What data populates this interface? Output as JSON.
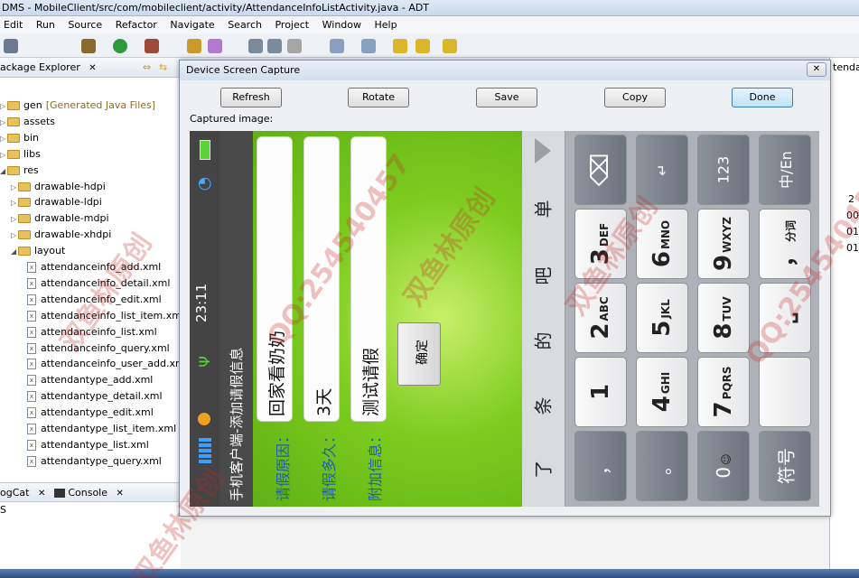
{
  "window": {
    "title": "DMS - MobileClient/src/com/mobileclient/activity/AttendanceInfoListActivity.java - ADT"
  },
  "menu": [
    "Edit",
    "Run",
    "Source",
    "Refactor",
    "Navigate",
    "Search",
    "Project",
    "Window",
    "Help"
  ],
  "package_explorer": {
    "title": "ackage Explorer",
    "items": [
      {
        "label": "gen",
        "suffix": "[Generated Java Files]",
        "kind": "folder",
        "depth": 0,
        "open": false
      },
      {
        "label": "assets",
        "kind": "folder",
        "depth": 0,
        "open": false
      },
      {
        "label": "bin",
        "kind": "folder",
        "depth": 0,
        "open": false
      },
      {
        "label": "libs",
        "kind": "folder",
        "depth": 0,
        "open": false
      },
      {
        "label": "res",
        "kind": "folder",
        "depth": 0,
        "open": true
      },
      {
        "label": "drawable-hdpi",
        "kind": "folder",
        "depth": 1,
        "open": false
      },
      {
        "label": "drawable-ldpi",
        "kind": "folder",
        "depth": 1,
        "open": false
      },
      {
        "label": "drawable-mdpi",
        "kind": "folder",
        "depth": 1,
        "open": false
      },
      {
        "label": "drawable-xhdpi",
        "kind": "folder",
        "depth": 1,
        "open": false
      },
      {
        "label": "layout",
        "kind": "folder",
        "depth": 1,
        "open": true
      },
      {
        "label": "attendanceinfo_add.xml",
        "kind": "file",
        "depth": 2
      },
      {
        "label": "attendanceinfo_detail.xml",
        "kind": "file",
        "depth": 2
      },
      {
        "label": "attendanceinfo_edit.xml",
        "kind": "file",
        "depth": 2
      },
      {
        "label": "attendanceinfo_list_item.xml",
        "kind": "file",
        "depth": 2
      },
      {
        "label": "attendanceinfo_list.xml",
        "kind": "file",
        "depth": 2
      },
      {
        "label": "attendanceinfo_query.xml",
        "kind": "file",
        "depth": 2
      },
      {
        "label": "attendanceinfo_user_add.xml",
        "kind": "file",
        "depth": 2
      },
      {
        "label": "attendantype_add.xml",
        "kind": "file",
        "depth": 2
      },
      {
        "label": "attendantype_detail.xml",
        "kind": "file",
        "depth": 2
      },
      {
        "label": "attendantype_edit.xml",
        "kind": "file",
        "depth": 2
      },
      {
        "label": "attendantype_list_item.xml",
        "kind": "file",
        "depth": 2
      },
      {
        "label": "attendantype_list.xml",
        "kind": "file",
        "depth": 2
      },
      {
        "label": "attendantype_query.xml",
        "kind": "file",
        "depth": 2
      }
    ]
  },
  "bottom_tabs": {
    "logcat": "ogCat",
    "console": "Console",
    "line": "S"
  },
  "right_strip": {
    "tab": "tendanc",
    "numbers": [
      "2",
      "00",
      "01",
      "01"
    ]
  },
  "dialog": {
    "title": "Device Screen Capture",
    "buttons": {
      "refresh": "Refresh",
      "rotate": "Rotate",
      "save": "Save",
      "copy": "Copy",
      "done": "Done"
    },
    "captured_label": "Captured image:"
  },
  "phone": {
    "time": "23:11",
    "app_title": "手机客户端-添加请假信息",
    "form": [
      {
        "label": "请假原因：",
        "value": "回家看奶奶"
      },
      {
        "label": "请假多久：",
        "value": "3天"
      },
      {
        "label": "附加信息：",
        "value": "测试请假"
      }
    ],
    "confirm": "确定",
    "candidates": [
      "了",
      "条",
      "的",
      "吧",
      "单"
    ],
    "keys": {
      "col1": [
        {
          "big": "",
          "small": "",
          "kind": "del"
        },
        {
          "big": "3",
          "small": "DEF"
        },
        {
          "big": "2",
          "small": "ABC"
        },
        {
          "big": "1",
          "small": ""
        },
        {
          "big": "，",
          "small": ""
        }
      ],
      "col2": [
        {
          "big": "↵",
          "small": "",
          "kind": "enter"
        },
        {
          "big": "6",
          "small": "MNO"
        },
        {
          "big": "5",
          "small": "JKL"
        },
        {
          "big": "4",
          "small": "GHI"
        },
        {
          "big": "。",
          "small": ""
        }
      ],
      "col3": [
        {
          "big": "123",
          "small": "",
          "kind": "mode"
        },
        {
          "big": "9",
          "small": "WXYZ"
        },
        {
          "big": "8",
          "small": "TUV"
        },
        {
          "big": "7",
          "small": "PQRS"
        },
        {
          "big": "0",
          "small": "☺"
        }
      ],
      "col4": [
        {
          "big": "中/En",
          "small": "",
          "kind": "lang"
        },
        {
          "big": "，",
          "small": "分词"
        },
        {
          "big": "⎵",
          "small": ""
        },
        {
          "big": "",
          "small": ""
        },
        {
          "big": "符号",
          "small": ""
        }
      ]
    }
  },
  "watermarks": [
    "双鱼林原创",
    "QQ:254540457",
    "双鱼林原创",
    "双鱼林原创",
    "QQ:254540457",
    "双鱼林原创"
  ],
  "colors": {
    "accent_done": "#bfe3f7",
    "phone_green": "#7dcc1e",
    "label_blue": "#1f5fb0"
  }
}
